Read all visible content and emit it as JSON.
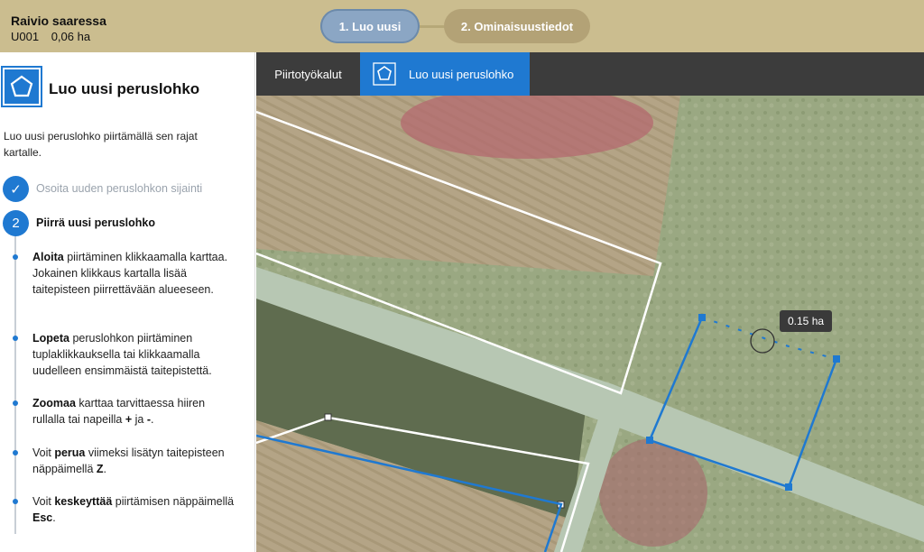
{
  "header": {
    "parcel_name": "Raivio saaressa",
    "parcel_id": "U001",
    "parcel_area": "0,06 ha",
    "steps": [
      {
        "label": "1. Luo uusi",
        "state": "active"
      },
      {
        "label": "2. Ominaisuustiedot",
        "state": "inactive"
      }
    ],
    "colors": {
      "bar": "#cbbd8f",
      "active_step": "#8ba6c4",
      "inactive_step": "#b3a276"
    }
  },
  "sidebar": {
    "title": "Luo uusi peruslohko",
    "title_icon": "pentagon-icon",
    "intro": "Luo uusi peruslohko piirtämällä sen rajat kartalle.",
    "steps": [
      {
        "marker": "✓",
        "label": "Osoita uuden peruslohkon sijainti",
        "state": "done"
      },
      {
        "marker": "2",
        "label": "Piirrä uusi peruslohko",
        "state": "active"
      }
    ],
    "instructions": [
      {
        "bold": "Aloita",
        "text": " piirtäminen klikkaamalla karttaa. Jokainen klikkaus kartalla lisää taitepisteen piirrettävään alueeseen."
      },
      {
        "bold": "Lopeta",
        "text": " peruslohkon piirtäminen tuplaklikkauksella tai klikkaamalla uudelleen ensimmäistä taitepistettä."
      },
      {
        "pre": "",
        "bold": "Zoomaa",
        "text": " karttaa tarvittaessa hiiren rullalla tai napeilla ",
        "key1": "+",
        "mid": " ja ",
        "key2": "-",
        "post": "."
      },
      {
        "pre": "Voit ",
        "bold": "perua",
        "text": " viimeksi lisätyn taitepisteen näppäimellä ",
        "key1": "Z",
        "post": "."
      },
      {
        "pre": "Voit ",
        "bold": "keskeyttää",
        "text": " piirtämisen näppäimellä ",
        "key1": "Esc",
        "post": "."
      }
    ],
    "accent": "#1f79d1"
  },
  "map": {
    "toolbar": {
      "draw_tools_label": "Piirtotyökalut",
      "new_parcel_label": "Luo uusi peruslohko",
      "new_parcel_icon": "pentagon-icon"
    },
    "area_tooltip": "0.15 ha",
    "colors": {
      "drawn_polygon": "#1f79d1",
      "existing_parcel": "#ffffff"
    }
  }
}
